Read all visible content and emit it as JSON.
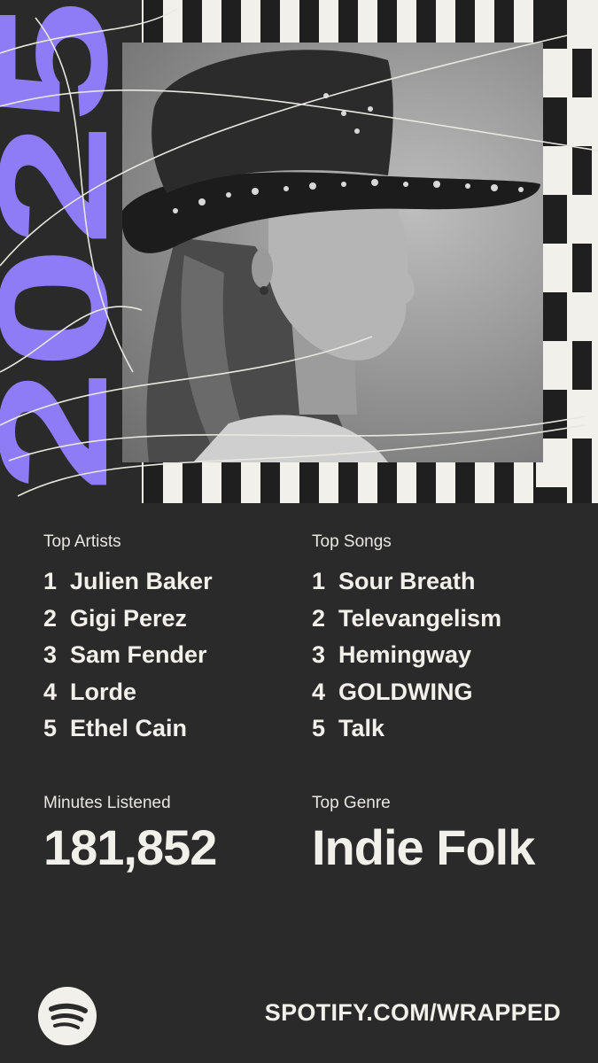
{
  "year_graphic": "2025",
  "colors": {
    "background": "#2a2a2a",
    "text": "#f2f0ea",
    "accent": "#8e7cf6"
  },
  "photo": {
    "icon": "artist-portrait-image",
    "description": ""
  },
  "top_artists": {
    "heading": "Top Artists",
    "items": [
      {
        "rank": "1",
        "name": "Julien Baker"
      },
      {
        "rank": "2",
        "name": "Gigi Perez"
      },
      {
        "rank": "3",
        "name": "Sam Fender"
      },
      {
        "rank": "4",
        "name": "Lorde"
      },
      {
        "rank": "5",
        "name": "Ethel Cain"
      }
    ]
  },
  "top_songs": {
    "heading": "Top Songs",
    "items": [
      {
        "rank": "1",
        "name": "Sour Breath"
      },
      {
        "rank": "2",
        "name": "Televangelism"
      },
      {
        "rank": "3",
        "name": "Hemingway"
      },
      {
        "rank": "4",
        "name": "GOLDWING"
      },
      {
        "rank": "5",
        "name": "Talk"
      }
    ]
  },
  "minutes": {
    "heading": "Minutes Listened",
    "value": "181,852"
  },
  "genre": {
    "heading": "Top Genre",
    "value": "Indie Folk"
  },
  "footer": {
    "logo_icon": "spotify-logo-icon",
    "link": "SPOTIFY.COM/WRAPPED"
  }
}
